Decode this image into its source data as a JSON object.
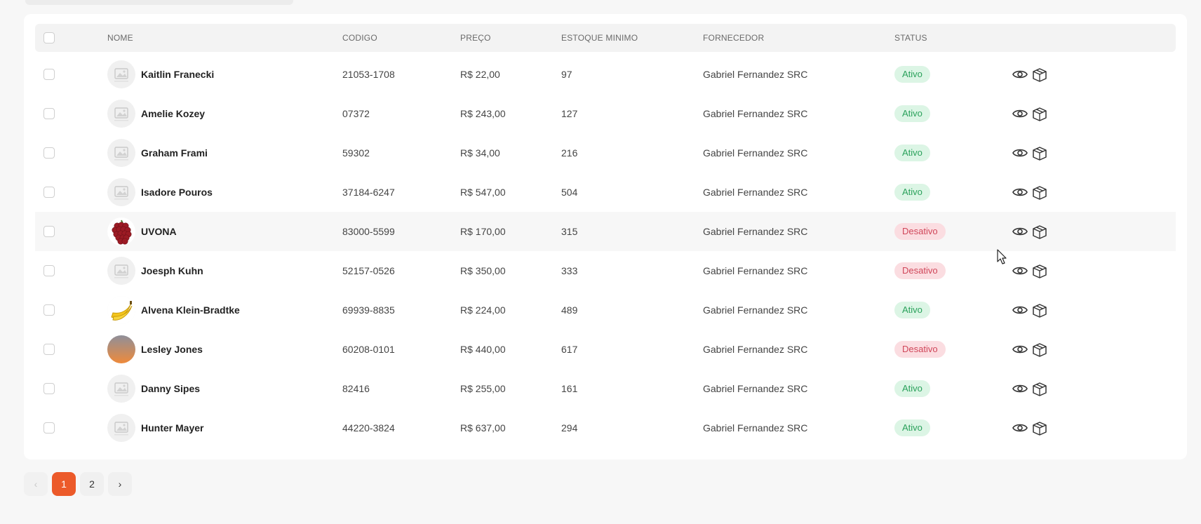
{
  "table": {
    "headers": {
      "name": "NOME",
      "code": "CODIGO",
      "price": "PREÇO",
      "min_stock": "ESTOQUE MINIMO",
      "supplier": "FORNECEDOR",
      "status": "STATUS"
    },
    "rows": [
      {
        "name": "Kaitlin Franecki",
        "code": "21053-1708",
        "price": "R$ 22,00",
        "min_stock": "97",
        "supplier": "Gabriel Fernandez SRC",
        "status": "Ativo",
        "active": true,
        "image": "placeholder-image"
      },
      {
        "name": "Amelie Kozey",
        "code": "07372",
        "price": "R$ 243,00",
        "min_stock": "127",
        "supplier": "Gabriel Fernandez SRC",
        "status": "Ativo",
        "active": true,
        "image": "placeholder-image"
      },
      {
        "name": "Graham Frami",
        "code": "59302",
        "price": "R$ 34,00",
        "min_stock": "216",
        "supplier": "Gabriel Fernandez SRC",
        "status": "Ativo",
        "active": true,
        "image": "placeholder-image"
      },
      {
        "name": "Isadore Pouros",
        "code": "37184-6247",
        "price": "R$ 547,00",
        "min_stock": "504",
        "supplier": "Gabriel Fernandez SRC",
        "status": "Ativo",
        "active": true,
        "image": "placeholder-image"
      },
      {
        "name": "UVONA",
        "code": "83000-5599",
        "price": "R$ 170,00",
        "min_stock": "315",
        "supplier": "Gabriel Fernandez SRC",
        "status": "Desativo",
        "active": false,
        "image": "grapes-image"
      },
      {
        "name": "Joesph Kuhn",
        "code": "52157-0526",
        "price": "R$ 350,00",
        "min_stock": "333",
        "supplier": "Gabriel Fernandez SRC",
        "status": "Desativo",
        "active": false,
        "image": "placeholder-image"
      },
      {
        "name": "Alvena Klein-Bradtke",
        "code": "69939-8835",
        "price": "R$ 224,00",
        "min_stock": "489",
        "supplier": "Gabriel Fernandez SRC",
        "status": "Ativo",
        "active": true,
        "image": "banana-image"
      },
      {
        "name": "Lesley Jones",
        "code": "60208-0101",
        "price": "R$ 440,00",
        "min_stock": "617",
        "supplier": "Gabriel Fernandez SRC",
        "status": "Desativo",
        "active": false,
        "image": "gradient-image"
      },
      {
        "name": "Danny Sipes",
        "code": "82416",
        "price": "R$ 255,00",
        "min_stock": "161",
        "supplier": "Gabriel Fernandez SRC",
        "status": "Ativo",
        "active": true,
        "image": "placeholder-image"
      },
      {
        "name": "Hunter Mayer",
        "code": "44220-3824",
        "price": "R$ 637,00",
        "min_stock": "294",
        "supplier": "Gabriel Fernandez SRC",
        "status": "Ativo",
        "active": true,
        "image": "placeholder-image"
      }
    ],
    "row_actions": [
      "eye-icon",
      "box-icon"
    ]
  },
  "pagination": {
    "prev": "‹",
    "pages": [
      "1",
      "2"
    ],
    "current": "1",
    "next": "›"
  },
  "colors": {
    "accent": "#ec5a2a",
    "active_bg": "#dcf5e5",
    "active_text": "#2aa15b",
    "inactive_bg": "#fbdde1",
    "inactive_text": "#d0475a"
  }
}
